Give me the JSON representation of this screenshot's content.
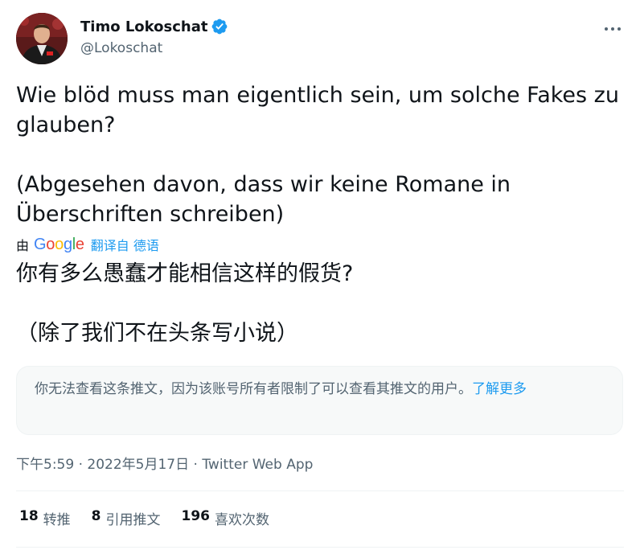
{
  "author": {
    "display_name": "Timo Lokoschat",
    "handle": "@Lokoschat",
    "verified": true
  },
  "tweet": {
    "paragraphs": [
      "Wie blöd muss man eigentlich sein, um solche Fakes zu glauben?",
      "(Abgesehen davon, dass wir keine Romane in Überschriften schreiben)"
    ]
  },
  "translation": {
    "by_label": "由",
    "google": "Google",
    "translated_from": "翻译自 德语",
    "paragraphs": [
      "你有多么愚蠢才能相信这样的假货?",
      "（除了我们不在头条写小说）"
    ]
  },
  "notice": {
    "text": "你无法查看这条推文，因为该账号所有者限制了可以查看其推文的用户。",
    "learn_more": "了解更多"
  },
  "meta": {
    "time": "下午5:59",
    "separator1": " · ",
    "date": "2022年5月17日",
    "separator2": " · ",
    "source": "Twitter Web App"
  },
  "stats": [
    {
      "count": "18",
      "label": "转推"
    },
    {
      "count": "8",
      "label": "引用推文"
    },
    {
      "count": "196",
      "label": "喜欢次数"
    }
  ],
  "colors": {
    "accent": "#1d9bf0",
    "text": "#0f1419",
    "secondary": "#536471"
  },
  "icons": {
    "verified": "verified-badge-icon",
    "more": "more-options-icon"
  }
}
